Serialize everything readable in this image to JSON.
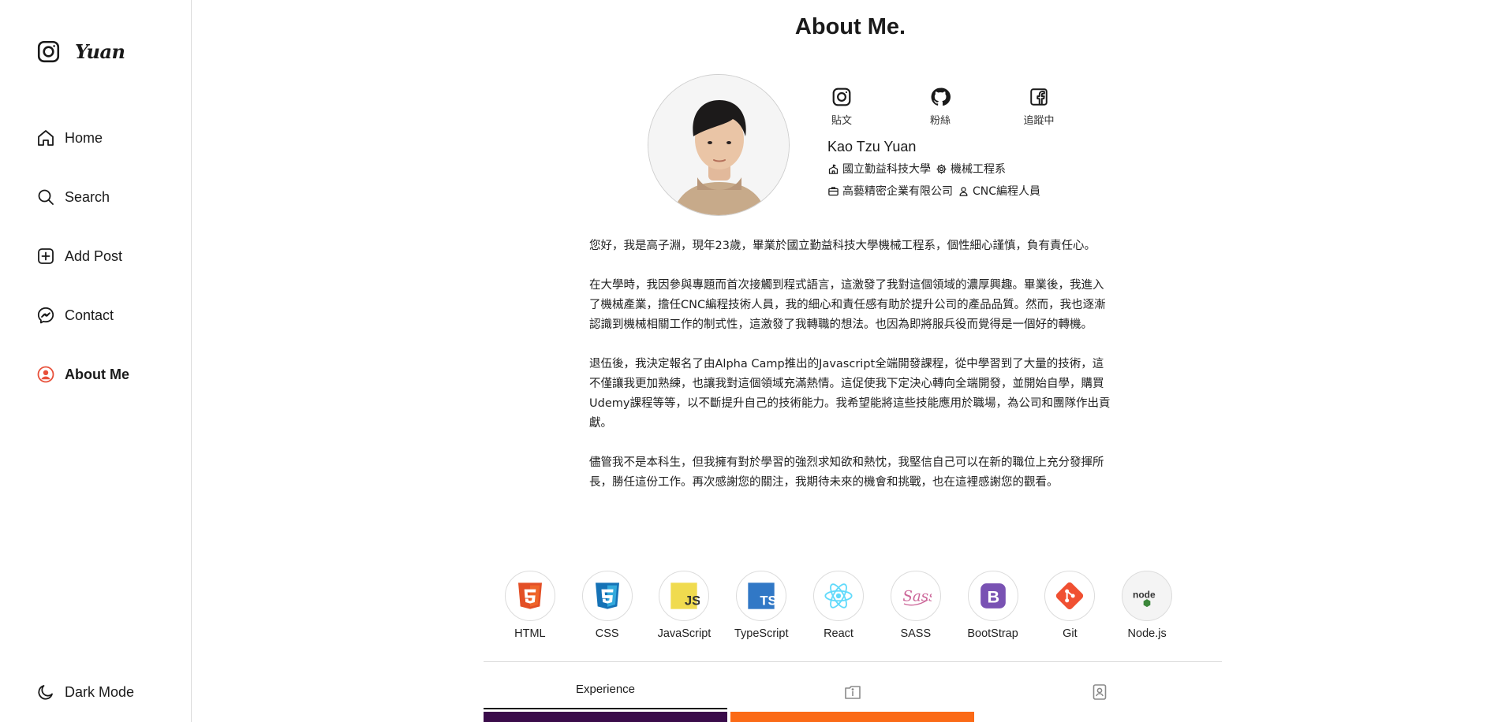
{
  "brand": {
    "name": "Yuan",
    "icon": "instagram-icon"
  },
  "nav": {
    "home": "Home",
    "search": "Search",
    "add_post": "Add Post",
    "contact": "Contact",
    "about_me": "About Me",
    "dark_mode": "Dark Mode"
  },
  "page_title": "About Me.",
  "socials": [
    {
      "icon": "instagram-icon",
      "label": "貼文"
    },
    {
      "icon": "github-icon",
      "label": "粉絲"
    },
    {
      "icon": "facebook-icon",
      "label": "追蹤中"
    }
  ],
  "profile": {
    "name": "Kao Tzu Yuan",
    "school": "國立勤益科技大學",
    "department": "機械工程系",
    "company": "高藝精密企業有限公司",
    "role": "CNC編程人員"
  },
  "bio": [
    "您好，我是高子淵，現年23歲，畢業於國立勤益科技大學機械工程系，個性細心謹慎，負有責任心。",
    "在大學時，我因參與專題而首次接觸到程式語言，這激發了我對這個領域的濃厚興趣。畢業後，我進入了機械產業，擔任CNC編程技術人員，我的細心和責任感有助於提升公司的產品品質。然而，我也逐漸認識到機械相關工作的制式性，這激發了我轉職的想法。也因為即將服兵役而覺得是一個好的轉機。",
    "退伍後，我決定報名了由Alpha Camp推出的Javascript全端開發課程，從中學習到了大量的技術，這不僅讓我更加熟練，也讓我對這個領域充滿熱情。這促使我下定決心轉向全端開發，並開始自學，購買Udemy課程等等，以不斷提升自己的技術能力。我希望能將這些技能應用於職場，為公司和團隊作出貢獻。",
    "儘管我不是本科生，但我擁有對於學習的強烈求知欲和熱忱，我堅信自己可以在新的職位上充分發揮所長，勝任這份工作。再次感謝您的關注，我期待未來的機會和挑戰，也在這裡感謝您的觀看。"
  ],
  "skills": [
    {
      "name": "HTML",
      "icon": "html5-icon",
      "color": "#e34f26"
    },
    {
      "name": "CSS",
      "icon": "css3-icon",
      "color": "#1572b6"
    },
    {
      "name": "JavaScript",
      "icon": "javascript-icon",
      "color": "#f0db4f"
    },
    {
      "name": "TypeScript",
      "icon": "typescript-icon",
      "color": "#3178c6"
    },
    {
      "name": "React",
      "icon": "react-icon",
      "color": "#61dafb"
    },
    {
      "name": "SASS",
      "icon": "sass-icon",
      "color": "#cc6699"
    },
    {
      "name": "BootStrap",
      "icon": "bootstrap-icon",
      "color": "#7952b3"
    },
    {
      "name": "Git",
      "icon": "git-icon",
      "color": "#f05032"
    },
    {
      "name": "Node.js",
      "icon": "nodejs-icon",
      "color": "#3c873a"
    }
  ],
  "tabs": {
    "experience": "Experience",
    "info_icon": "info-card-icon",
    "profile_icon": "contact-card-icon"
  },
  "colors": {
    "card_purple": "#3a0b4a",
    "card_orange": "#fb6a16",
    "active_nav_icon": "#e8503a"
  }
}
